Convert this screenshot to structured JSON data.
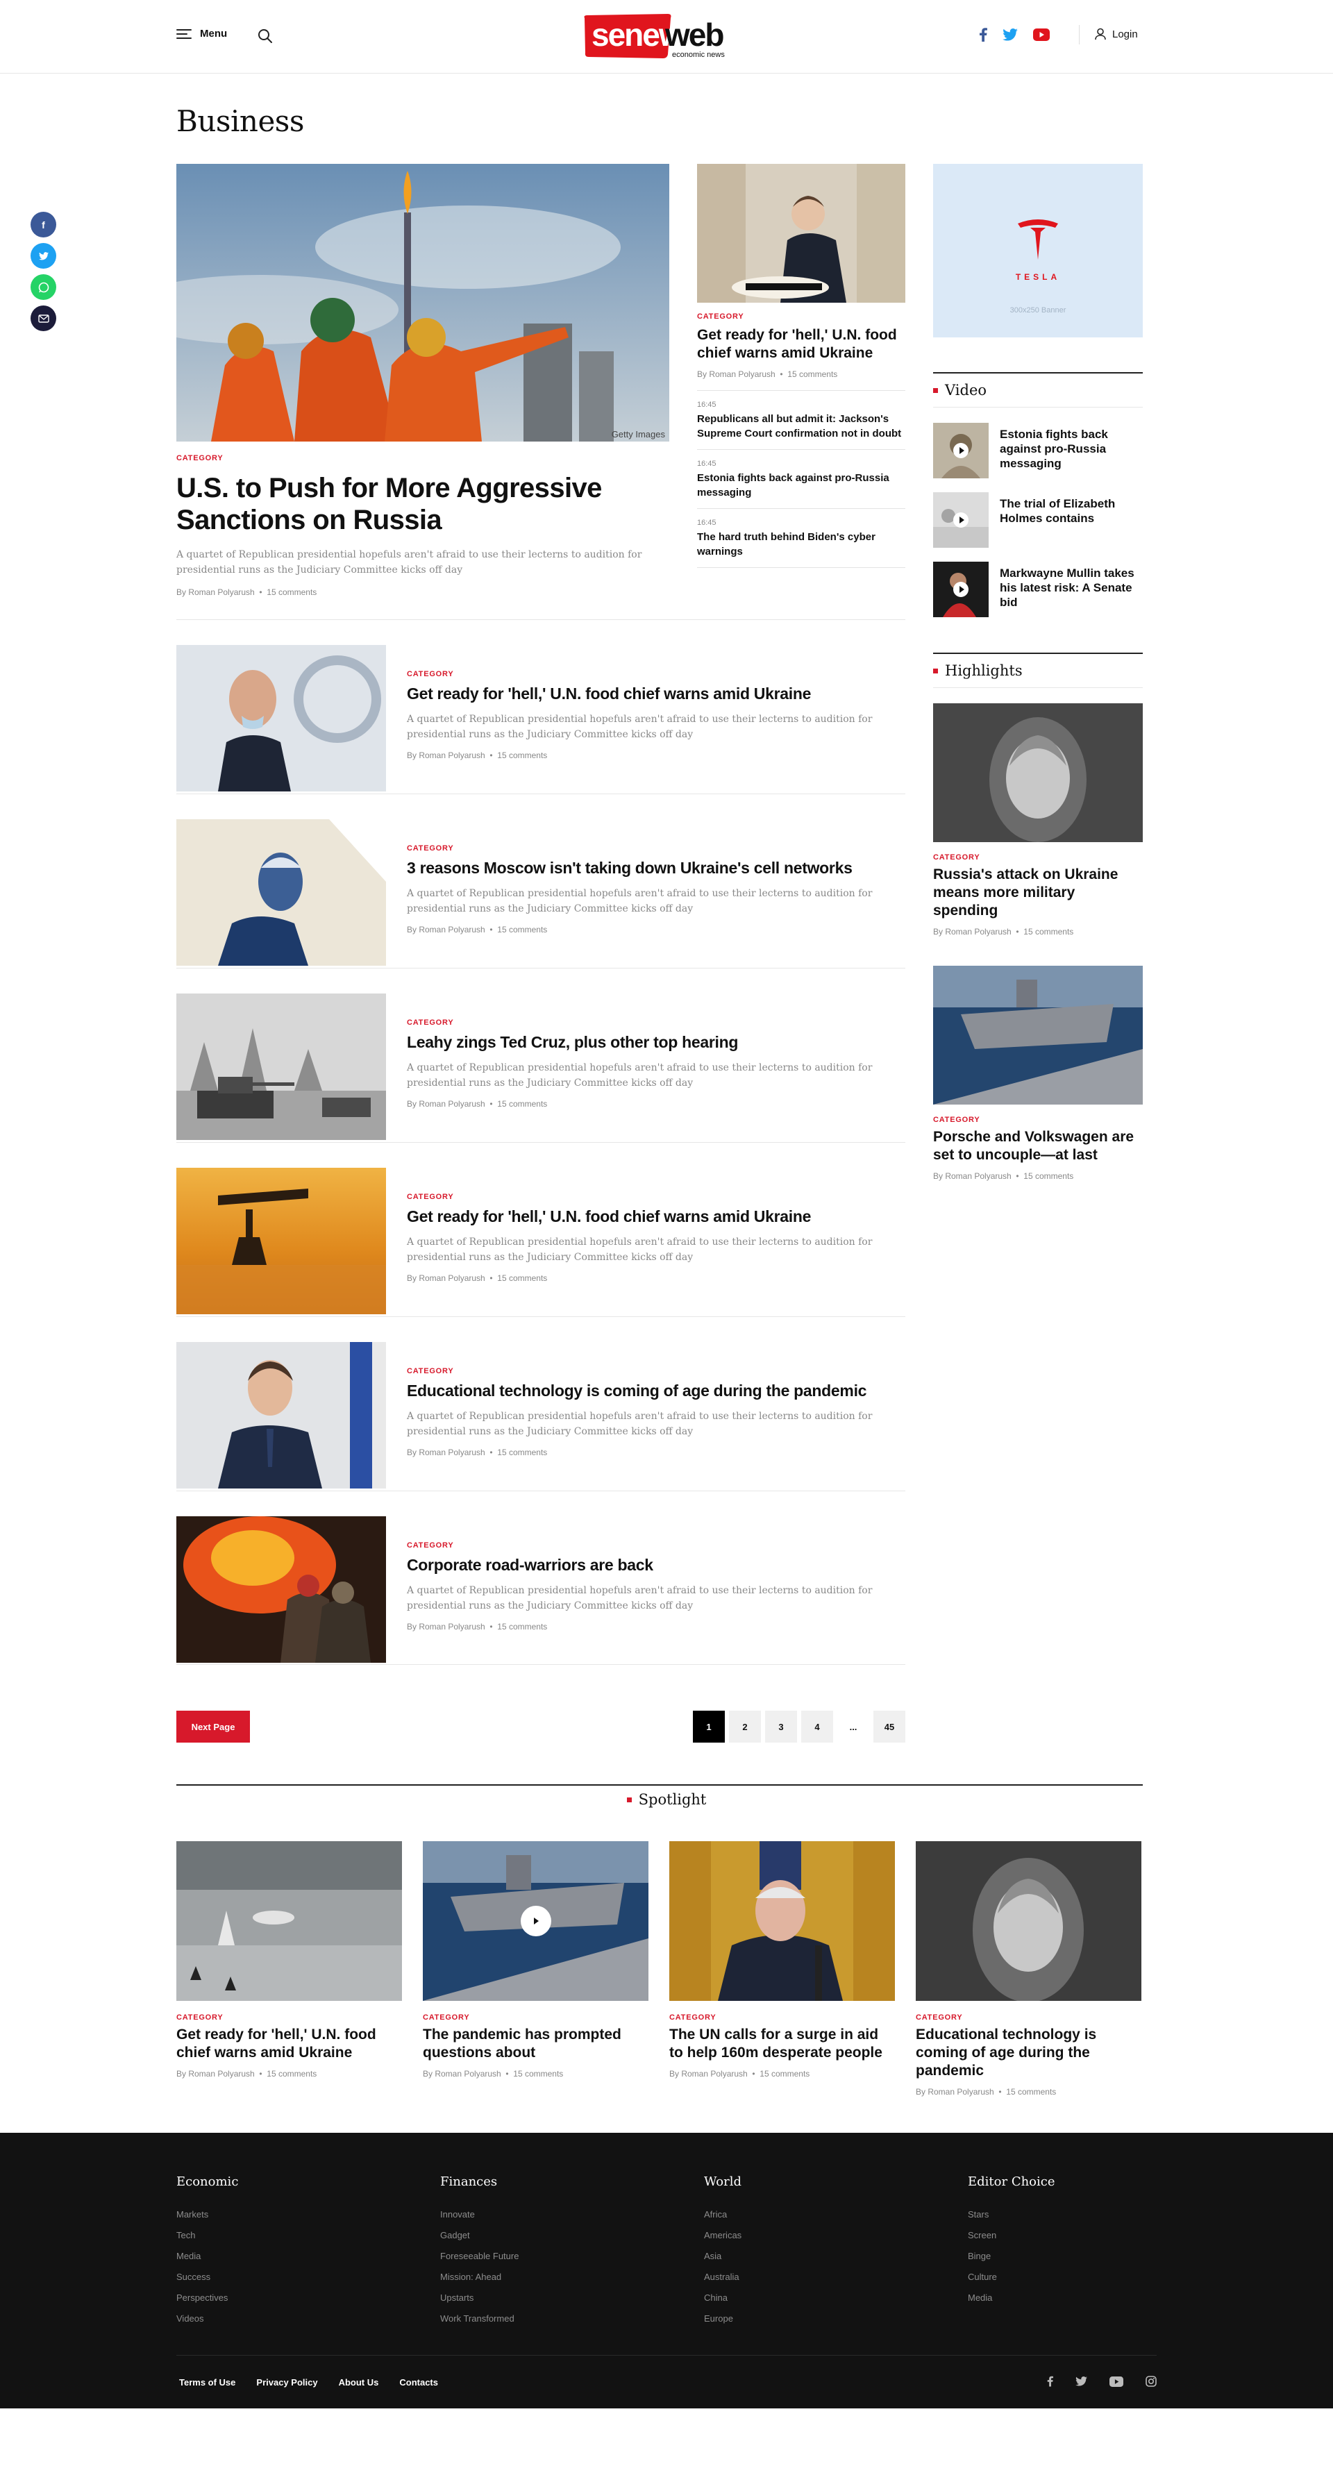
{
  "header": {
    "menu_label": "Menu",
    "logo_main": "seneweb",
    "logo_sub": "economic news",
    "login_label": "Login",
    "social": [
      "facebook-icon",
      "twitter-icon",
      "youtube-icon"
    ]
  },
  "page_title": "Business",
  "hero": {
    "category": "CATEGORY",
    "title": "U.S. to Push for More Aggressive Sanctions on Russia",
    "excerpt": "A quartet of Republican presidential hopefuls aren't afraid to use their lecterns to audition for presidential runs as the Judiciary Committee kicks off day",
    "author": "By Roman Polyarush",
    "comments": "15 comments",
    "image_credit": "Getty Images"
  },
  "mid_feature": {
    "category": "CATEGORY",
    "title": "Get ready for 'hell,' U.N. food chief warns amid Ukraine",
    "author": "By Roman Polyarush",
    "comments": "15 comments"
  },
  "latest": [
    {
      "time": "16:45",
      "title": "Republicans all but admit it: Jackson's Supreme Court confirmation not in doubt"
    },
    {
      "time": "16:45",
      "title": "Estonia fights back against pro-Russia messaging"
    },
    {
      "time": "16:45",
      "title": "The hard truth behind Biden's cyber warnings"
    }
  ],
  "banner": {
    "brand": "TESLA",
    "label": "300x250 Banner"
  },
  "video": {
    "heading": "Video",
    "items": [
      {
        "title": "Estonia fights back against pro-Russia messaging"
      },
      {
        "title": "The trial of Elizabeth Holmes contains"
      },
      {
        "title": "Markwayne Mullin takes his latest risk: A Senate bid"
      }
    ]
  },
  "highlights": {
    "heading": "Highlights",
    "items": [
      {
        "category": "CATEGORY",
        "title": "Russia's attack on Ukraine means more military spending",
        "author": "By Roman Polyarush",
        "comments": "15 comments"
      },
      {
        "category": "CATEGORY",
        "title": "Porsche and Volkswagen are set to uncouple—at last",
        "author": "By Roman Polyarush",
        "comments": "15 comments"
      }
    ]
  },
  "articles": [
    {
      "category": "CATEGORY",
      "title": "Get ready for 'hell,' U.N. food chief warns amid Ukraine",
      "excerpt": "A quartet of Republican presidential hopefuls aren't afraid to use their lecterns to audition for presidential runs as the Judiciary Committee kicks off day",
      "author": "By Roman Polyarush",
      "comments": "15 comments"
    },
    {
      "category": "CATEGORY",
      "title": "3 reasons Moscow isn't taking down Ukraine's cell networks",
      "excerpt": "A quartet of Republican presidential hopefuls aren't afraid to use their lecterns to audition for presidential runs as the Judiciary Committee kicks off day",
      "author": "By Roman Polyarush",
      "comments": "15 comments"
    },
    {
      "category": "CATEGORY",
      "title": "Leahy zings Ted Cruz, plus other top hearing",
      "excerpt": "A quartet of Republican presidential hopefuls aren't afraid to use their lecterns to audition for presidential runs as the Judiciary Committee kicks off day",
      "author": "By Roman Polyarush",
      "comments": "15 comments"
    },
    {
      "category": "CATEGORY",
      "title": "Get ready for 'hell,' U.N. food chief warns amid Ukraine",
      "excerpt": "A quartet of Republican presidential hopefuls aren't afraid to use their lecterns to audition for presidential runs as the Judiciary Committee kicks off day",
      "author": "By Roman Polyarush",
      "comments": "15 comments"
    },
    {
      "category": "CATEGORY",
      "title": "Educational technology is coming of age during the pandemic",
      "excerpt": "A quartet of Republican presidential hopefuls aren't afraid to use their lecterns to audition for presidential runs as the Judiciary Committee kicks off day",
      "author": "By Roman Polyarush",
      "comments": "15 comments"
    },
    {
      "category": "CATEGORY",
      "title": "Corporate road-warriors are back",
      "excerpt": "A quartet of Republican presidential hopefuls aren't afraid to use their lecterns to audition for presidential runs as the Judiciary Committee kicks off day",
      "author": "By Roman Polyarush",
      "comments": "15 comments"
    }
  ],
  "pagination": {
    "next_label": "Next Page",
    "pages": [
      "1",
      "2",
      "3",
      "4",
      "...",
      "45"
    ],
    "current": "1"
  },
  "spotlight": {
    "heading": "Spotlight",
    "items": [
      {
        "category": "CATEGORY",
        "title": "Get ready for 'hell,' U.N. food chief warns amid Ukraine",
        "author": "By Roman Polyarush",
        "comments": "15 comments"
      },
      {
        "category": "CATEGORY",
        "title": "The pandemic has prompted questions about",
        "author": "By Roman Polyarush",
        "comments": "15 comments"
      },
      {
        "category": "CATEGORY",
        "title": "The UN calls for a surge in aid to help 160m desperate people",
        "author": "By Roman Polyarush",
        "comments": "15 comments"
      },
      {
        "category": "CATEGORY",
        "title": "Educational technology is coming of age during the pandemic",
        "author": "By Roman Polyarush",
        "comments": "15 comments"
      }
    ]
  },
  "footer": {
    "columns": [
      {
        "heading": "Economic",
        "links": [
          "Markets",
          "Tech",
          "Media",
          "Success",
          "Perspectives",
          "Videos"
        ]
      },
      {
        "heading": "Finances",
        "links": [
          "Innovate",
          "Gadget",
          "Foreseeable Future",
          "Mission: Ahead",
          "Upstarts",
          "Work Transformed"
        ]
      },
      {
        "heading": "World",
        "links": [
          "Africa",
          "Americas",
          "Asia",
          "Australia",
          "China",
          "Europe"
        ]
      },
      {
        "heading": "Editor Choice",
        "links": [
          "Stars",
          "Screen",
          "Binge",
          "Culture",
          "Media"
        ]
      }
    ],
    "bottom_links": [
      "Terms of Use",
      "Privacy Policy",
      "About Us",
      "Contacts"
    ],
    "social": [
      "facebook-icon",
      "twitter-icon",
      "youtube-icon",
      "instagram-icon"
    ]
  },
  "colors": {
    "accent": "#d7192b",
    "footer_bg": "#121212",
    "banner_bg": "#dbe9f7"
  }
}
